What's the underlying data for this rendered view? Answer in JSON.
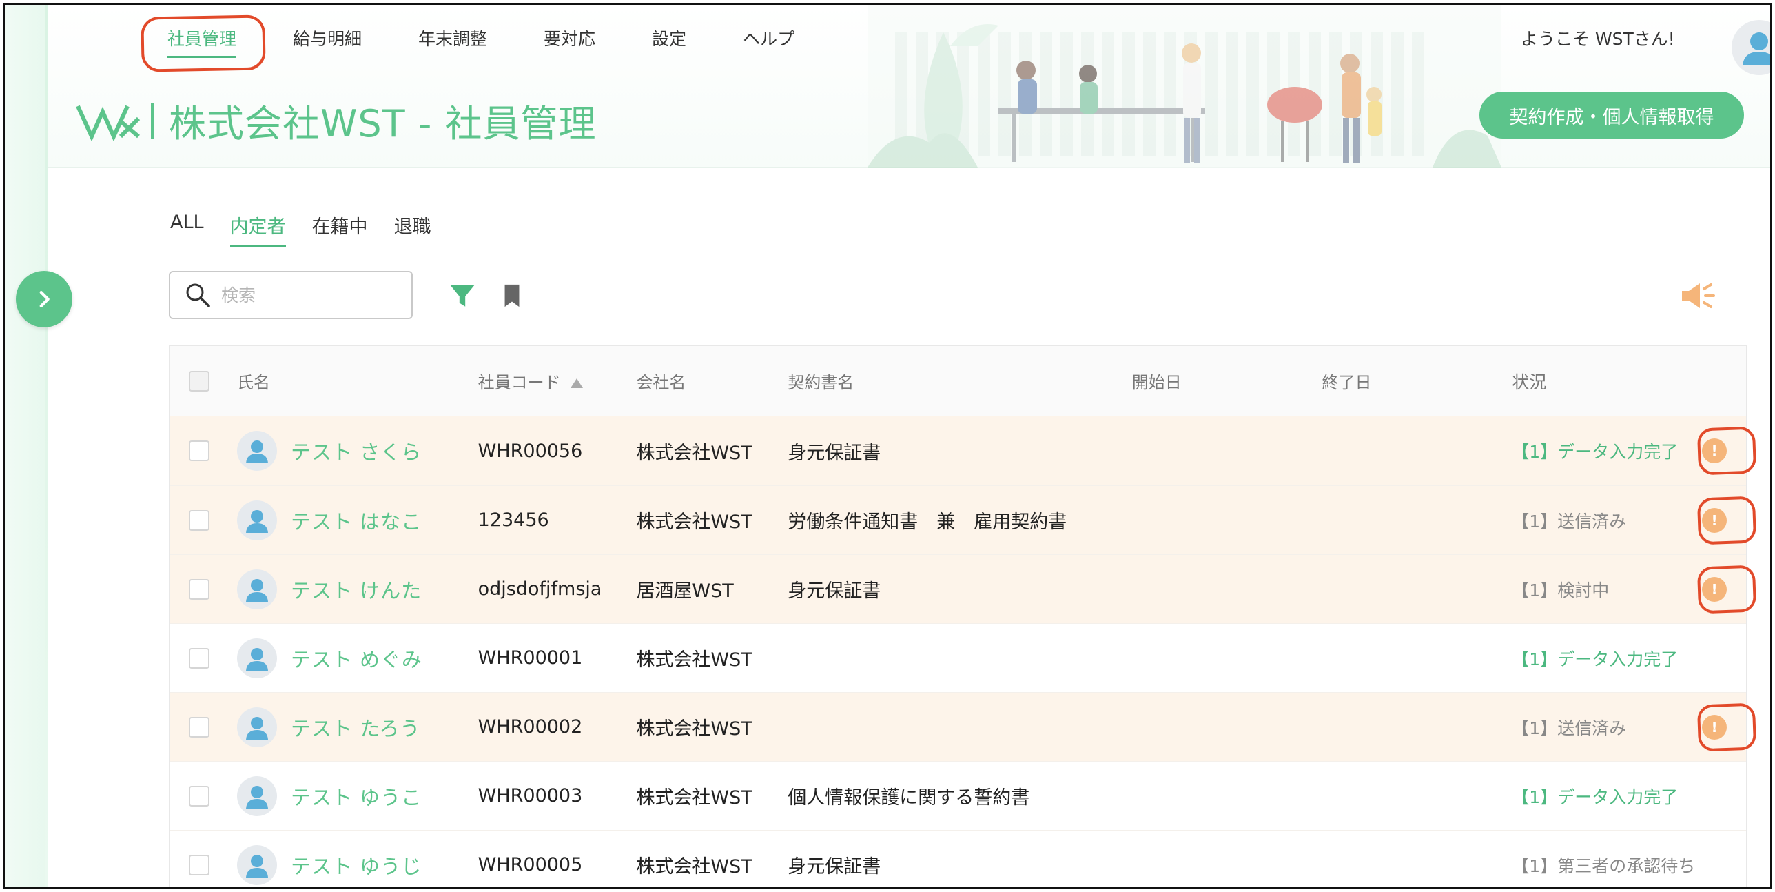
{
  "nav": {
    "items": [
      {
        "label": "社員管理",
        "active": true
      },
      {
        "label": "給与明細",
        "active": false
      },
      {
        "label": "年末調整",
        "active": false
      },
      {
        "label": "要対応",
        "active": false
      },
      {
        "label": "設定",
        "active": false
      },
      {
        "label": "ヘルプ",
        "active": false
      }
    ]
  },
  "header": {
    "title": "株式会社WST - 社員管理",
    "welcome": "ようこそ WSTさん!",
    "cta_label": "契約作成・個人情報取得"
  },
  "tabs": [
    {
      "label": "ALL",
      "active": false
    },
    {
      "label": "内定者",
      "active": true
    },
    {
      "label": "在籍中",
      "active": false
    },
    {
      "label": "退職",
      "active": false
    }
  ],
  "search": {
    "placeholder": "検索"
  },
  "table": {
    "columns": {
      "name": "氏名",
      "code": "社員コード",
      "company": "会社名",
      "contract": "契約書名",
      "start": "開始日",
      "end": "終了日",
      "status": "状況"
    },
    "rows": [
      {
        "name": "テスト さくら",
        "code": "WHR00056",
        "company": "株式会社WST",
        "contract": "身元保証書",
        "start": "",
        "end": "",
        "status": "【1】データ入力完了",
        "status_color": "green",
        "warning": true
      },
      {
        "name": "テスト はなこ",
        "code": "123456",
        "company": "株式会社WST",
        "contract": "労働条件通知書　兼　雇用契約書",
        "start": "",
        "end": "",
        "status": "【1】送信済み",
        "status_color": "gray",
        "warning": true
      },
      {
        "name": "テスト けんた",
        "code": "odjsdofjfmsja",
        "company": "居酒屋WST",
        "contract": "身元保証書",
        "start": "",
        "end": "",
        "status": "【1】検討中",
        "status_color": "gray",
        "warning": true
      },
      {
        "name": "テスト めぐみ",
        "code": "WHR00001",
        "company": "株式会社WST",
        "contract": "",
        "start": "",
        "end": "",
        "status": "【1】データ入力完了",
        "status_color": "green",
        "warning": false
      },
      {
        "name": "テスト たろう",
        "code": "WHR00002",
        "company": "株式会社WST",
        "contract": "",
        "start": "",
        "end": "",
        "status": "【1】送信済み",
        "status_color": "gray",
        "warning": true
      },
      {
        "name": "テスト ゆうこ",
        "code": "WHR00003",
        "company": "株式会社WST",
        "contract": "個人情報保護に関する誓約書",
        "start": "",
        "end": "",
        "status": "【1】データ入力完了",
        "status_color": "green",
        "warning": false
      },
      {
        "name": "テスト ゆうじ",
        "code": "WHR00005",
        "company": "株式会社WST",
        "contract": "身元保証書",
        "start": "",
        "end": "",
        "status": "【1】第三者の承認待ち",
        "status_color": "gray",
        "warning": false
      }
    ]
  },
  "colors": {
    "accent": "#5cc48b",
    "warning_row": "#fdf4ea",
    "warning_icon": "#f5b57a",
    "annotation": "#e24a2a"
  },
  "icons": {
    "sidebar_toggle": "chevron-right-icon",
    "search": "search-icon",
    "filter": "filter-icon",
    "bookmark": "bookmark-icon",
    "announce": "megaphone-icon",
    "warning": "exclamation-icon"
  }
}
